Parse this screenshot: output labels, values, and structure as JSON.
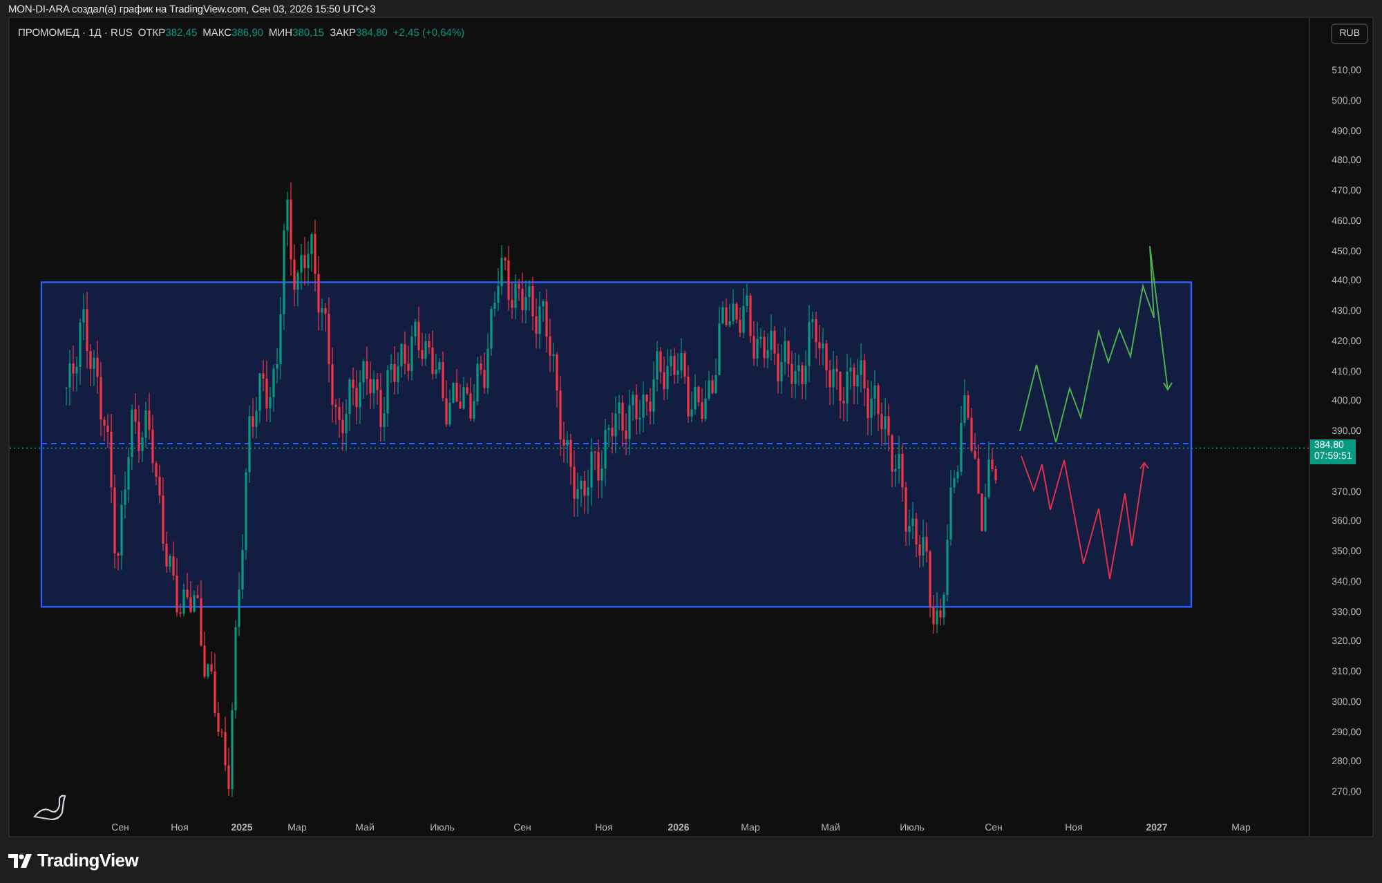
{
  "header": {
    "title": "MON-DI-ARA создал(а) график на TradingView.com, Сен 03, 2026 15:50 UTC+3"
  },
  "legend": {
    "symbol": "ПРОМОМЕД · 1Д · RUS",
    "fields": [
      {
        "label": "ОТКР",
        "value": "382,45"
      },
      {
        "label": "МАКС",
        "value": "386,90"
      },
      {
        "label": "МИН",
        "value": "380,15"
      },
      {
        "label": "ЗАКР",
        "value": "384,80"
      }
    ],
    "change": "+2,45 (+0,64%)"
  },
  "price_axis": {
    "currency": "RUB",
    "ticks": [
      "510,00",
      "500,00",
      "490,00",
      "480,00",
      "470,00",
      "460,00",
      "450,00",
      "440,00",
      "430,00",
      "420,00",
      "410,00",
      "400,00",
      "390,00",
      "370,00",
      "360,00",
      "350,00",
      "340,00",
      "330,00",
      "320,00",
      "310,00",
      "300,00",
      "290,00",
      "280,00",
      "270,00"
    ],
    "current_price": "384,80",
    "countdown": "07:59:51"
  },
  "time_axis": {
    "labels": [
      "Сен",
      "Ноя",
      "2025",
      "Мар",
      "Май",
      "Июль",
      "Сен",
      "Ноя",
      "2026",
      "Мар",
      "Май",
      "Июль",
      "Сен",
      "Ноя",
      "2027",
      "Мар"
    ]
  },
  "footer": {
    "brand": "TradingView"
  }
}
